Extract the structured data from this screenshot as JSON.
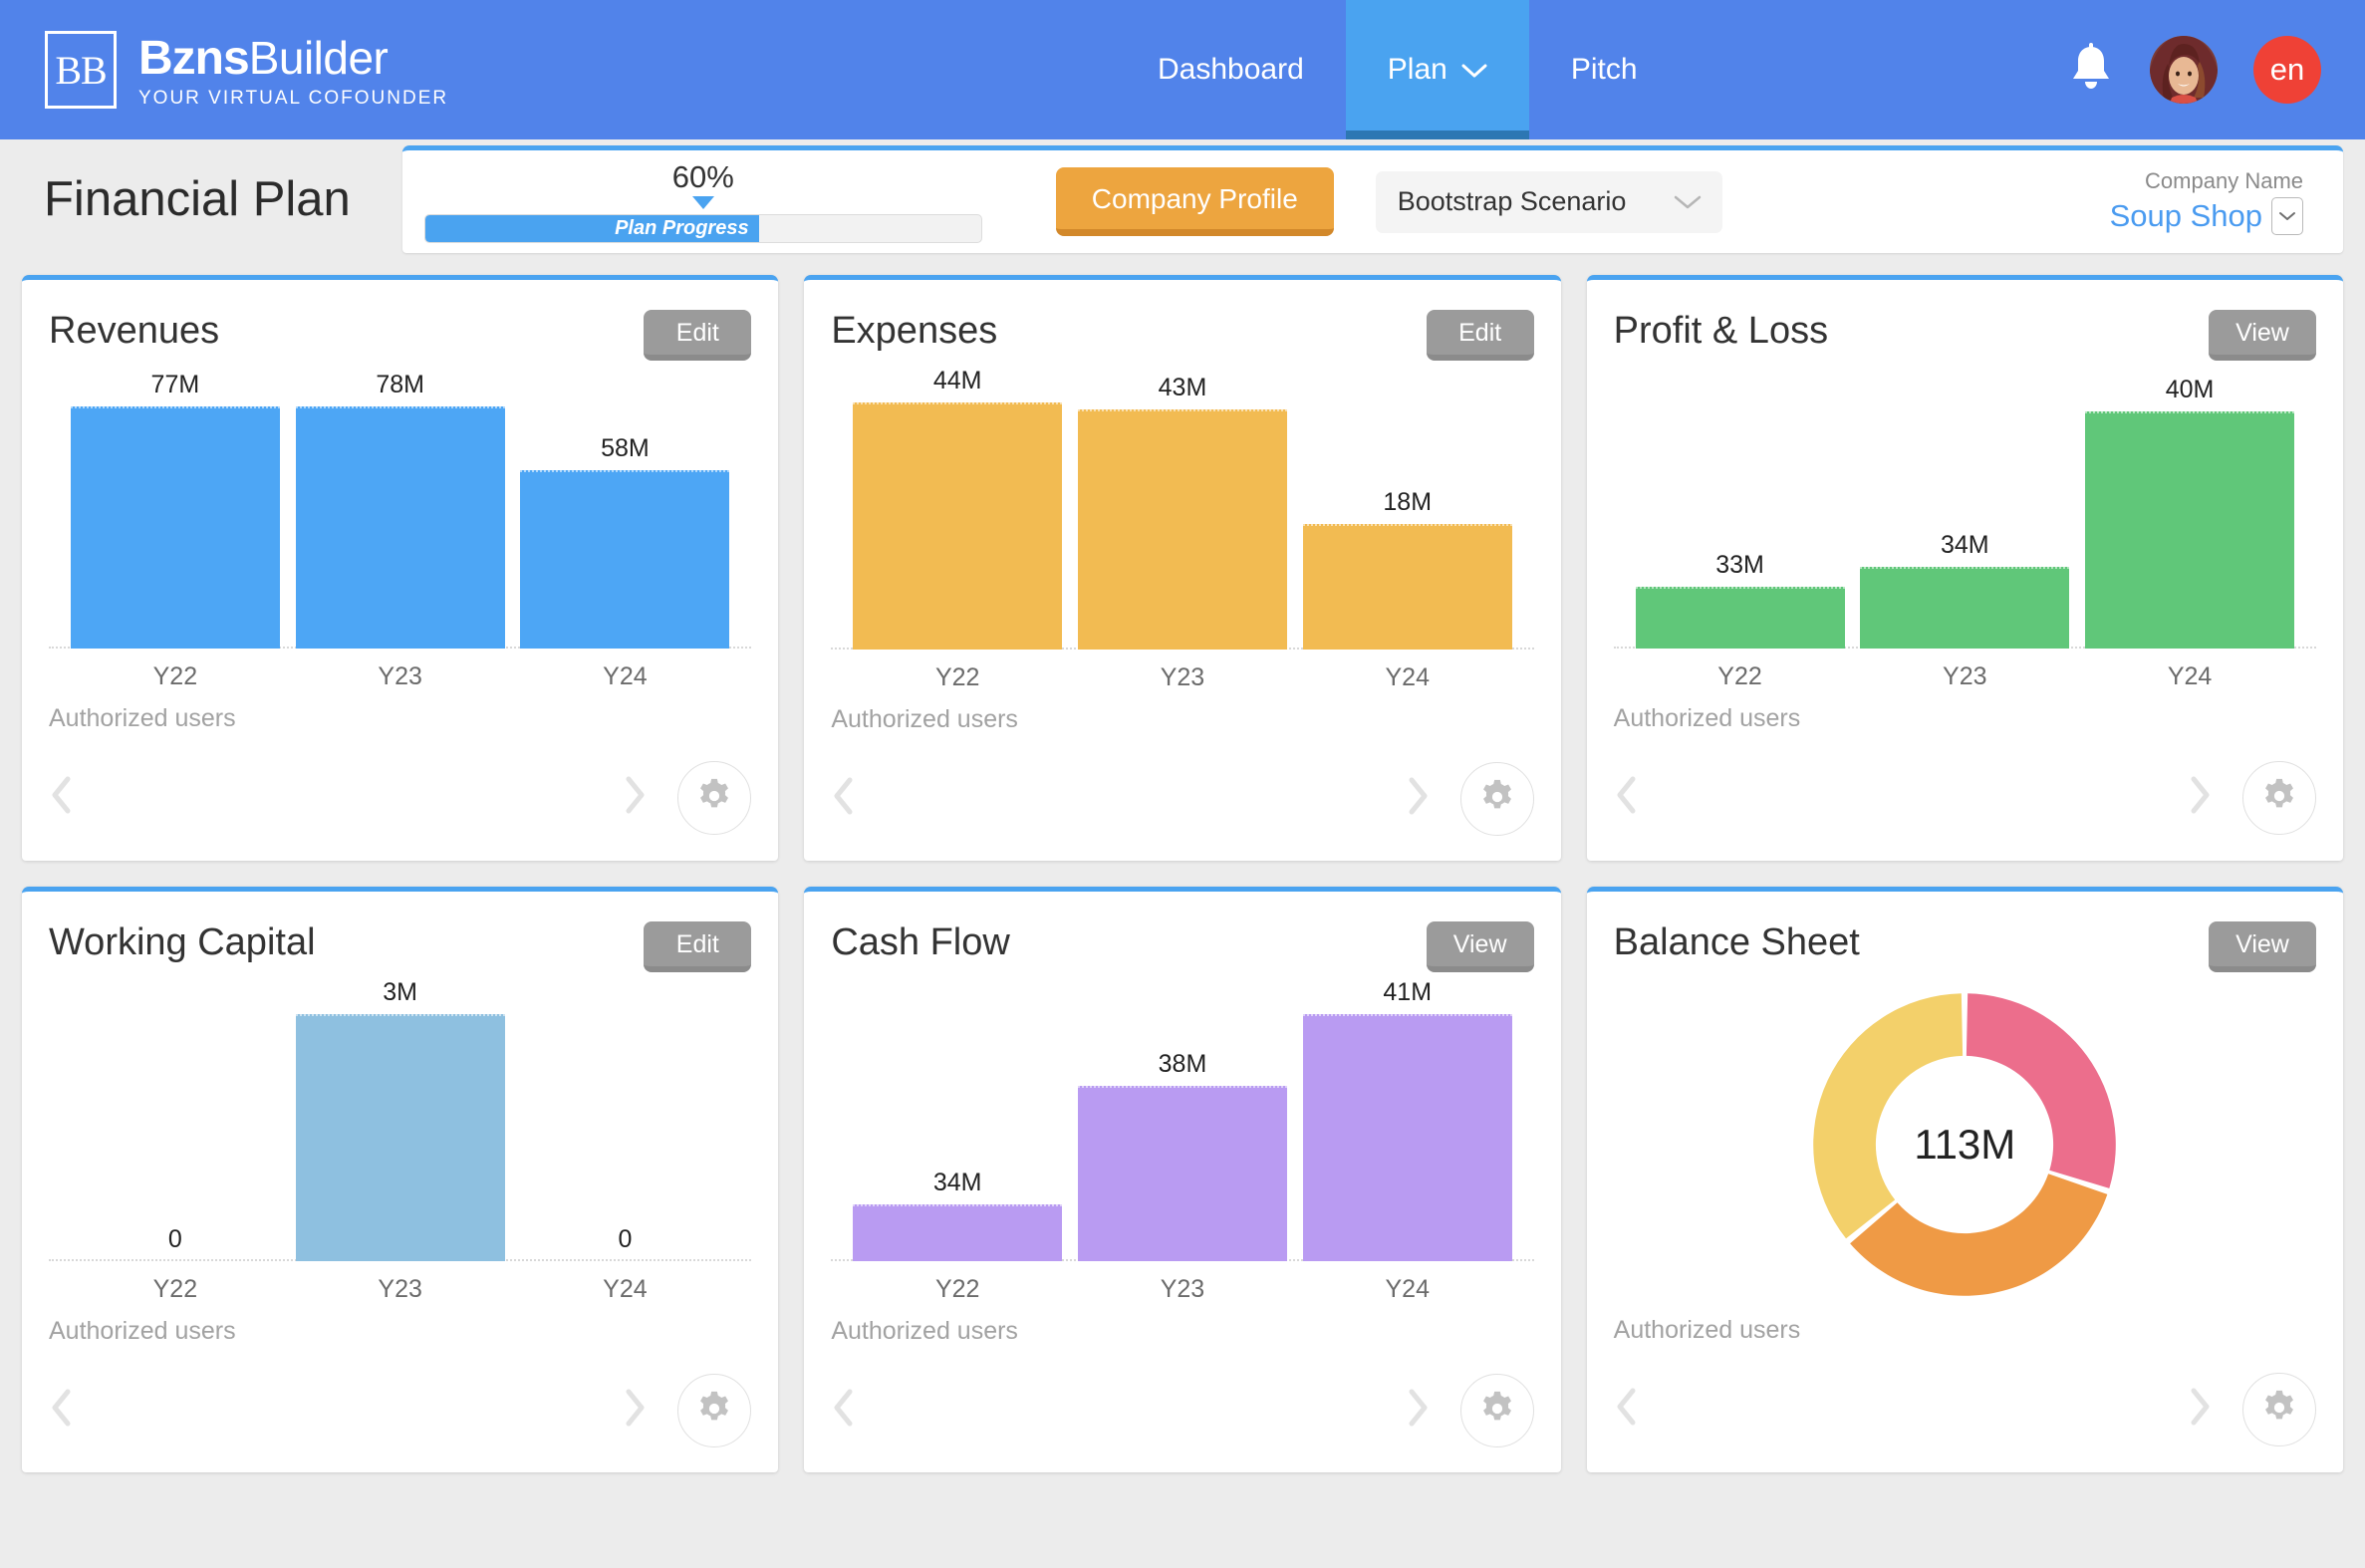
{
  "header": {
    "logo": {
      "mark": "BB",
      "name_bold": "Bzns",
      "name_light": "Builder",
      "tagline": "YOUR VIRTUAL COFOUNDER"
    },
    "nav": [
      {
        "label": "Dashboard",
        "active": false,
        "caret": ""
      },
      {
        "label": "Plan",
        "active": true,
        "caret": "⌄"
      },
      {
        "label": "Pitch",
        "active": false,
        "caret": ""
      }
    ],
    "bell_icon": "bell-icon",
    "avatar_icon": "user-avatar",
    "language": "en",
    "bg_color": "#5183ea",
    "active_tab_color": "#4aa3f0"
  },
  "toolbar": {
    "page_title": "Financial Plan",
    "progress": {
      "percent_label": "60%",
      "percent_value": 60,
      "bar_label": "Plan Progress"
    },
    "company_profile_button": "Company Profile",
    "scenario": {
      "selected": "Bootstrap Scenario",
      "caret": "∨"
    },
    "company": {
      "label": "Company Name",
      "name": "Soup Shop",
      "caret": "∨"
    }
  },
  "cards": [
    {
      "title": "Revenues",
      "action": "Edit",
      "footer_label": "Authorized users",
      "gear_icon": "gear-icon",
      "prev_icon": "chevron-left-icon",
      "next_icon": "chevron-right-icon"
    },
    {
      "title": "Expenses",
      "action": "Edit",
      "footer_label": "Authorized users",
      "gear_icon": "gear-icon",
      "prev_icon": "chevron-left-icon",
      "next_icon": "chevron-right-icon"
    },
    {
      "title": "Profit & Loss",
      "action": "View",
      "footer_label": "Authorized users",
      "gear_icon": "gear-icon",
      "prev_icon": "chevron-left-icon",
      "next_icon": "chevron-right-icon"
    },
    {
      "title": "Working Capital",
      "action": "Edit",
      "footer_label": "Authorized users",
      "gear_icon": "gear-icon",
      "prev_icon": "chevron-left-icon",
      "next_icon": "chevron-right-icon"
    },
    {
      "title": "Cash Flow",
      "action": "View",
      "footer_label": "Authorized users",
      "gear_icon": "gear-icon",
      "prev_icon": "chevron-left-icon",
      "next_icon": "chevron-right-icon"
    },
    {
      "title": "Balance Sheet",
      "action": "View",
      "footer_label": "Authorized users",
      "gear_icon": "gear-icon",
      "prev_icon": "chevron-left-icon",
      "next_icon": "chevron-right-icon"
    }
  ],
  "chart_data": [
    {
      "type": "bar",
      "title": "Revenues",
      "categories": [
        "Y22",
        "Y23",
        "Y24"
      ],
      "values": [
        77,
        78,
        58
      ],
      "labels": [
        "77M",
        "78M",
        "58M"
      ],
      "bar_pixel_heights": [
        98,
        98,
        72
      ],
      "color": "#4da6f5",
      "xlabel": "",
      "ylabel": "",
      "grid": false,
      "legend": "none"
    },
    {
      "type": "bar",
      "title": "Expenses",
      "categories": [
        "Y22",
        "Y23",
        "Y24"
      ],
      "values": [
        44,
        43,
        18
      ],
      "labels": [
        "44M",
        "43M",
        "18M"
      ],
      "bar_pixel_heights": [
        100,
        97,
        51
      ],
      "color": "#f2bb52",
      "xlabel": "",
      "ylabel": "",
      "grid": false,
      "legend": "none"
    },
    {
      "type": "bar",
      "title": "Profit & Loss",
      "categories": [
        "Y22",
        "Y23",
        "Y24"
      ],
      "values": [
        33,
        34,
        40
      ],
      "labels": [
        "33M",
        "34M",
        "40M"
      ],
      "bar_pixel_heights": [
        25,
        33,
        96
      ],
      "color": "#60c779",
      "xlabel": "",
      "ylabel": "",
      "grid": false,
      "legend": "none"
    },
    {
      "type": "bar",
      "title": "Working Capital",
      "categories": [
        "Y22",
        "Y23",
        "Y24"
      ],
      "values": [
        0,
        3,
        0
      ],
      "labels": [
        "0",
        "3M",
        "0"
      ],
      "bar_pixel_heights": [
        0,
        100,
        0
      ],
      "color": "#8ec0e0",
      "xlabel": "",
      "ylabel": "",
      "grid": false,
      "legend": "none"
    },
    {
      "type": "bar",
      "title": "Cash Flow",
      "categories": [
        "Y22",
        "Y23",
        "Y24"
      ],
      "values": [
        34,
        38,
        41
      ],
      "labels": [
        "34M",
        "38M",
        "41M"
      ],
      "bar_pixel_heights": [
        23,
        71,
        100
      ],
      "color": "#b99bf2",
      "xlabel": "",
      "ylabel": "",
      "grid": false,
      "legend": "none"
    },
    {
      "type": "pie",
      "title": "Balance Sheet",
      "center_label": "113M",
      "total": 113,
      "slices": [
        {
          "name": "slice-1",
          "percent": 30,
          "color": "#ec6e8c"
        },
        {
          "name": "slice-2",
          "percent": 34,
          "color": "#ef9a45"
        },
        {
          "name": "slice-3",
          "percent": 36,
          "color": "#f3d06a"
        }
      ],
      "legend": "none"
    }
  ]
}
